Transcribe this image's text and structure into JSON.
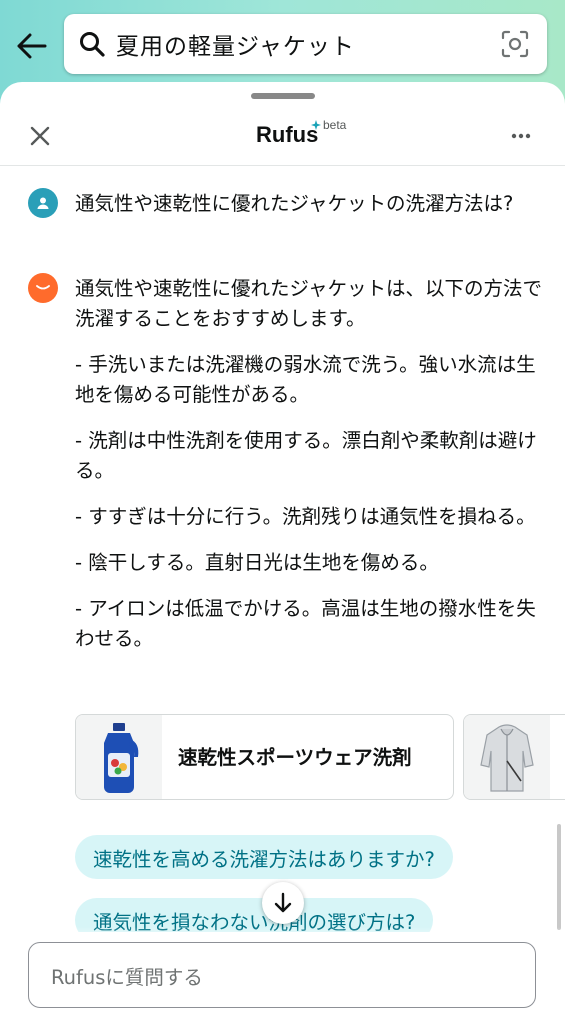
{
  "search": {
    "query": "夏用の軽量ジャケット"
  },
  "header": {
    "brand": "Rufus",
    "badge": "beta"
  },
  "chat": {
    "user_question": "通気性や速乾性に優れたジャケットの洗濯方法は?",
    "answer_paragraphs": [
      "通気性や速乾性に優れたジャケットは、以下の方法で洗濯することをおすすめします。",
      "- 手洗いまたは洗濯機の弱水流で洗う。強い水流は生地を傷める可能性がある。",
      "- 洗剤は中性洗剤を使用する。漂白剤や柔軟剤は避ける。",
      "- すすぎは十分に行う。洗剤残りは通気性を損ねる。",
      "- 陰干しする。直射日光は生地を傷める。",
      "- アイロンは低温でかける。高温は生地の撥水性を失わせる。"
    ]
  },
  "products": [
    {
      "title": "速乾性スポーツウェア洗剤",
      "icon": "detergent-bottle-icon"
    },
    {
      "title": "",
      "icon": "jacket-icon"
    }
  ],
  "suggestions": [
    "速乾性を高める洗濯方法はありますか?",
    "通気性を損なわない洗剤の選び方は?"
  ],
  "input": {
    "placeholder": "Rufusに質問する"
  },
  "colors": {
    "accent": "#007185",
    "chip_bg": "#d7f5f7",
    "user_avatar": "#2a9fb8",
    "rufus_avatar": "#ff6b2c"
  }
}
